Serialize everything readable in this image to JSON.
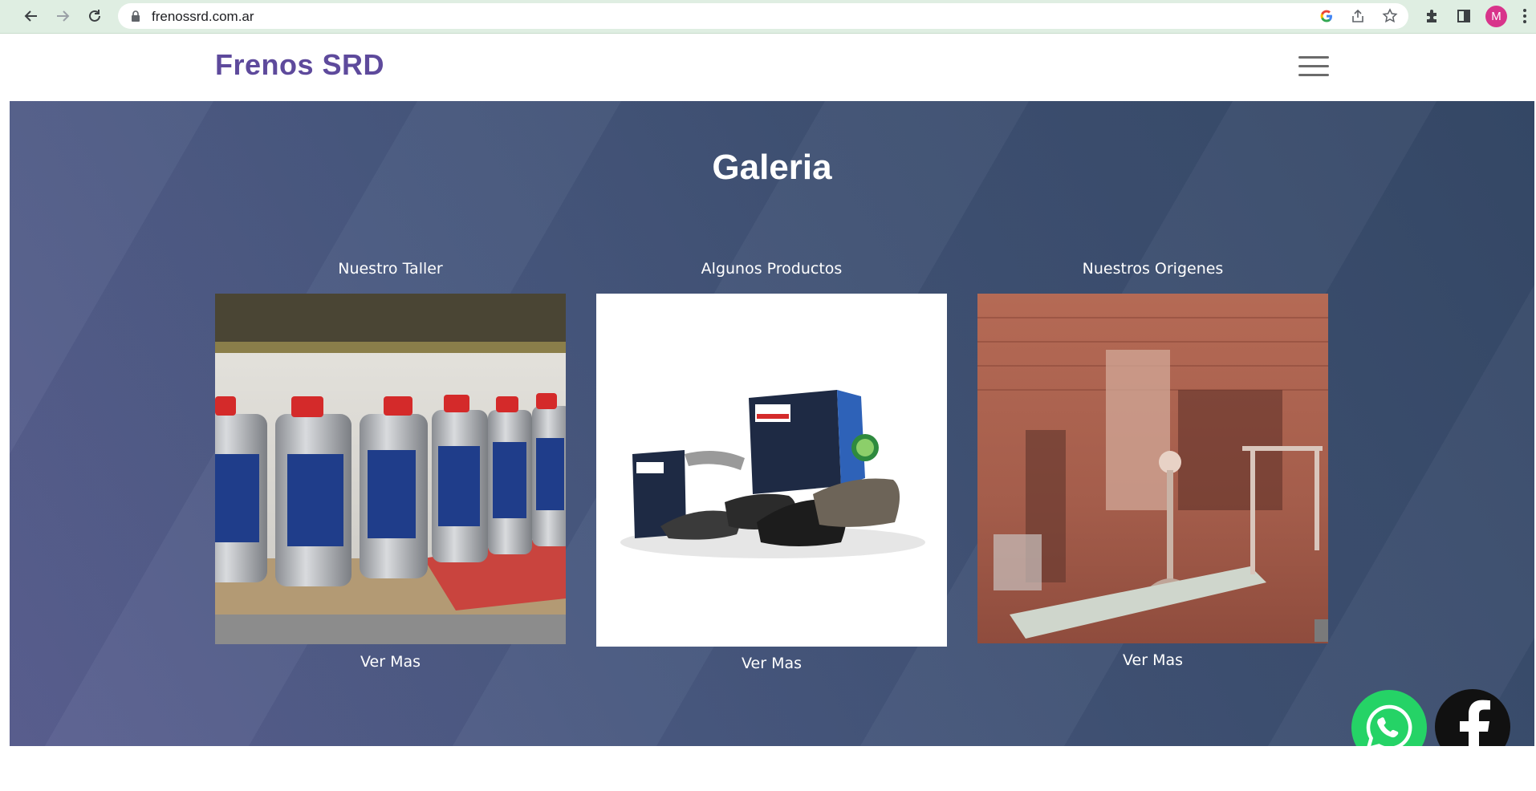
{
  "browser": {
    "url": "frenossrd.com.ar",
    "avatar_letter": "M",
    "accent": "#dfeee2"
  },
  "site": {
    "brand": "Frenos SRD",
    "brand_color": "#5e4a9c"
  },
  "gallery": {
    "title": "Galeria",
    "cards": [
      {
        "title": "Nuestro Taller",
        "link": "Ver Mas",
        "image": "brake-fluid-bottles-photo"
      },
      {
        "title": "Algunos Productos",
        "link": "Ver Mas",
        "image": "brake-pads-product-photo"
      },
      {
        "title": "Nuestros Origenes",
        "link": "Ver Mas",
        "image": "old-workshop-photo"
      }
    ]
  },
  "floating": {
    "whatsapp_color": "#25d366",
    "facebook_color": "#111111"
  }
}
